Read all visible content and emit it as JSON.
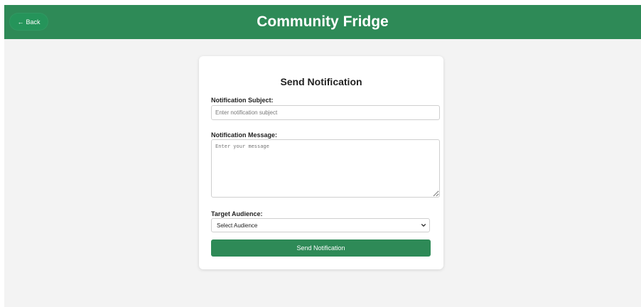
{
  "header": {
    "back_arrow": "←",
    "back_label": "Back",
    "title": "Community Fridge"
  },
  "form": {
    "title": "Send Notification",
    "subject": {
      "label": "Notification Subject:",
      "placeholder": "Enter notification subject",
      "value": ""
    },
    "message": {
      "label": "Notification Message:",
      "placeholder": "Enter your message",
      "value": ""
    },
    "audience": {
      "label": "Target Audience:",
      "selected": "Select Audience"
    },
    "submit_label": "Send Notification"
  },
  "colors": {
    "brand_green": "#2e8a57",
    "back_button": "#25945a",
    "page_background": "#f3f3f3"
  },
  "icons": {
    "back": "left-arrow-icon",
    "select": "chevron-down-icon"
  }
}
